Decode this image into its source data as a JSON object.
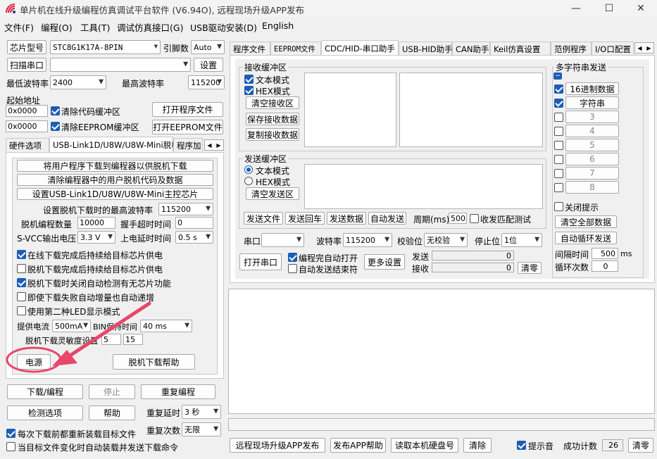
{
  "window": {
    "title": "单片机在线升级编程仿真调试平台软件 (V6.94O), 远程现场升级APP发布",
    "min": "—",
    "max": "☐",
    "close": "✕"
  },
  "menu": [
    "文件(F)",
    "编程(O)",
    "工具(T)",
    "调试仿真接口(G)",
    "USB驱动安装(D)",
    "English"
  ],
  "left": {
    "chip_label": "芯片型号",
    "chip_value": "STC8G1K17A-8PIN",
    "pin_label": "引脚数",
    "pin_value": "Auto",
    "scan_button": "扫描串口",
    "port_value": "",
    "settings_button": "设置",
    "min_baud_label": "最低波特率",
    "min_baud": "2400",
    "max_baud_label": "最高波特率",
    "max_baud": "115200",
    "start_addr_label": "起始地址",
    "addr1": "0x0000",
    "clear_code": "清除代码缓冲区",
    "open_program": "打开程序文件",
    "addr2": "0x0000",
    "clear_eeprom": "清除EEPROM缓冲区",
    "open_eeprom": "打开EEPROM文件",
    "tabs": [
      "硬件选项",
      "USB-Link1D/U8W/U8W-Mini脱机",
      "程序加"
    ],
    "offline": {
      "btn1": "将用户程序下载到编程器以供脱机下载",
      "btn2": "清除编程器中的用户脱机代码及数据",
      "btn3": "设置USB-Link1D/U8W/U8W-Mini主控芯片",
      "max_baud_label": "设置脱机下载时的最高波特率",
      "max_baud": "115200",
      "count_label": "脱机编程数量",
      "count": "10000",
      "handshake_label": "握手超时时间",
      "handshake": "0",
      "svcc_label": "S-VCC输出电压",
      "svcc": "3.3 V",
      "delay_label": "上电延时时间",
      "delay": "0.5 s",
      "opt1": "在线下载完成后持续给目标芯片供电",
      "opt2": "脱机下载完成后持续给目标芯片供电",
      "opt3": "脱机下载时关闭自动检测有无芯片功能",
      "opt4": "即使下载失败自动增量也自动递增",
      "opt5": "使用第二种LED显示模式",
      "current_label": "提供电流",
      "current": "500mA",
      "bin_label": "BIN保持时间",
      "bin": "40 ms",
      "sens_label": "脱机下载灵敏度设置",
      "sens1": "5",
      "sens2": "15",
      "power_button": "电源",
      "help_button": "脱机下载帮助"
    },
    "download_button": "下载/编程",
    "stop_button": "停止",
    "reprogram_button": "重复编程",
    "check_button": "检测选项",
    "help_button": "帮助",
    "repeat_delay_label": "重复延时",
    "repeat_delay": "3 秒",
    "repeat_count_label": "重复次数",
    "repeat_count": "无限",
    "reload_label": "每次下载前都重新装载目标文件",
    "auto_load_label": "当目标文件变化时自动装载并发送下载命令"
  },
  "right": {
    "tabs": [
      "程序文件",
      "EEPROM文件",
      "CDC/HID-串口助手",
      "USB-HID助手",
      "CAN助手",
      "Keil仿真设置",
      "范例程序",
      "I/O口配置"
    ],
    "recv": {
      "title": "接收缓冲区",
      "text_mode": "文本模式",
      "hex_mode": "HEX模式",
      "clear": "清空接收区",
      "save": "保存接收数据",
      "copy": "复制接收数据"
    },
    "send": {
      "title": "发送缓冲区",
      "text_mode": "文本模式",
      "hex_mode": "HEX模式",
      "clear": "清空发送区",
      "send_file": "发送文件",
      "send_return": "发送回车",
      "send_data": "发送数据",
      "auto_send": "自动发送",
      "period_label": "周期(ms)",
      "period": "500",
      "recv_match": "收发匹配测试"
    },
    "multi": {
      "title": "多字符串发送",
      "btn1": "16进制数据",
      "btn2": "字符串",
      "rows": [
        "3",
        "4",
        "5",
        "6",
        "7",
        "8"
      ],
      "close_hint": "关闭提示",
      "clear_all": "清空全部数据",
      "auto_loop": "自动循环发送",
      "interval_label": "间隔时间",
      "interval": "500",
      "interval_unit": "ms",
      "loop_label": "循环次数",
      "loop": "0"
    },
    "serial": {
      "port_label": "串口",
      "port": "",
      "baud_label": "波特率",
      "baud": "115200",
      "parity_label": "校验位",
      "parity": "无校验",
      "stop_label": "停止位",
      "stop": "1位",
      "open": "打开串口",
      "auto_open": "编程完自动打开",
      "auto_send_end": "自动发送结束符",
      "more": "更多设置",
      "send_label": "发送",
      "send_count": "0",
      "recv_label": "接收",
      "recv_count": "0",
      "clear": "清零"
    },
    "bottom": {
      "publish": "远程现场升级APP发布",
      "publish_help": "发布APP帮助",
      "read_disk": "读取本机硬盘号",
      "clear": "清除",
      "sound": "提示音",
      "success_label": "成功计数",
      "success": "26",
      "clear2": "清零"
    }
  },
  "colors": {
    "accent": "#1a5fb4",
    "annotation": "#e8476a"
  }
}
